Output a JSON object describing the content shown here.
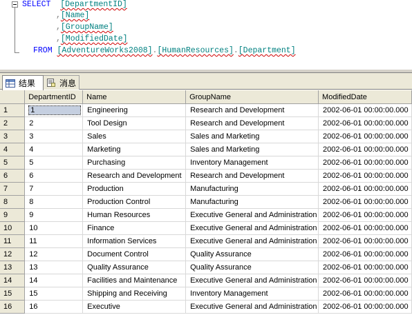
{
  "editor": {
    "select_kw": "SELECT",
    "from_kw": "FROM",
    "col1": "[DepartmentID]",
    "col2": "[Name]",
    "col3": "[GroupName]",
    "col4": "[ModifiedDate]",
    "comma": ",",
    "table_db": "[AdventureWorks2008]",
    "table_schema": "[HumanResources]",
    "table_name": "[Department]",
    "dot": "."
  },
  "tabs": {
    "results_label": "结果",
    "messages_label": "消息"
  },
  "grid": {
    "columns": [
      "DepartmentID",
      "Name",
      "GroupName",
      "ModifiedDate"
    ],
    "rows": [
      {
        "n": "1",
        "id": "1",
        "name": "Engineering",
        "group": "Research and Development",
        "date": "2002-06-01 00:00:00.000"
      },
      {
        "n": "2",
        "id": "2",
        "name": "Tool Design",
        "group": "Research and Development",
        "date": "2002-06-01 00:00:00.000"
      },
      {
        "n": "3",
        "id": "3",
        "name": "Sales",
        "group": "Sales and Marketing",
        "date": "2002-06-01 00:00:00.000"
      },
      {
        "n": "4",
        "id": "4",
        "name": "Marketing",
        "group": "Sales and Marketing",
        "date": "2002-06-01 00:00:00.000"
      },
      {
        "n": "5",
        "id": "5",
        "name": "Purchasing",
        "group": "Inventory Management",
        "date": "2002-06-01 00:00:00.000"
      },
      {
        "n": "6",
        "id": "6",
        "name": "Research and Development",
        "group": "Research and Development",
        "date": "2002-06-01 00:00:00.000"
      },
      {
        "n": "7",
        "id": "7",
        "name": "Production",
        "group": "Manufacturing",
        "date": "2002-06-01 00:00:00.000"
      },
      {
        "n": "8",
        "id": "8",
        "name": "Production Control",
        "group": "Manufacturing",
        "date": "2002-06-01 00:00:00.000"
      },
      {
        "n": "9",
        "id": "9",
        "name": "Human Resources",
        "group": "Executive General and Administration",
        "date": "2002-06-01 00:00:00.000"
      },
      {
        "n": "10",
        "id": "10",
        "name": "Finance",
        "group": "Executive General and Administration",
        "date": "2002-06-01 00:00:00.000"
      },
      {
        "n": "11",
        "id": "11",
        "name": "Information Services",
        "group": "Executive General and Administration",
        "date": "2002-06-01 00:00:00.000"
      },
      {
        "n": "12",
        "id": "12",
        "name": "Document Control",
        "group": "Quality Assurance",
        "date": "2002-06-01 00:00:00.000"
      },
      {
        "n": "13",
        "id": "13",
        "name": "Quality Assurance",
        "group": "Quality Assurance",
        "date": "2002-06-01 00:00:00.000"
      },
      {
        "n": "14",
        "id": "14",
        "name": "Facilities and Maintenance",
        "group": "Executive General and Administration",
        "date": "2002-06-01 00:00:00.000"
      },
      {
        "n": "15",
        "id": "15",
        "name": "Shipping and Receiving",
        "group": "Inventory Management",
        "date": "2002-06-01 00:00:00.000"
      },
      {
        "n": "16",
        "id": "16",
        "name": "Executive",
        "group": "Executive General and Administration",
        "date": "2002-06-01 00:00:00.000"
      }
    ]
  },
  "icons": {
    "results": "grid-icon",
    "messages": "message-icon",
    "outline": "collapse-box-icon"
  }
}
